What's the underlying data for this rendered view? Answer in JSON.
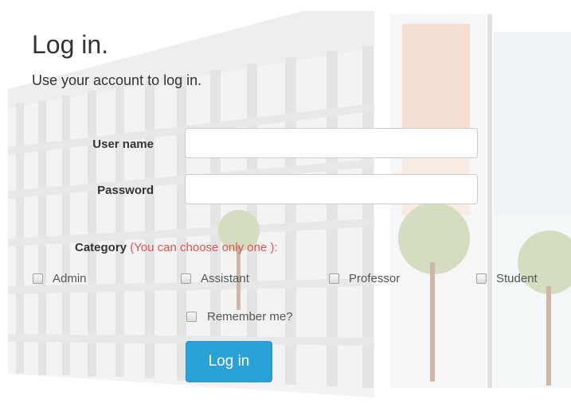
{
  "page": {
    "title": "Log in.",
    "subtitle": "Use your account to log in."
  },
  "form": {
    "username_label": "User name",
    "username_value": "",
    "password_label": "Password",
    "password_value": "",
    "category_label": "Category",
    "category_hint": "(You can choose only one ):",
    "category_options": [
      "Admin",
      "Assistant",
      "Professor",
      "Student"
    ],
    "remember_label": "Remember me?",
    "remember_checked": false,
    "submit_label": "Log in"
  },
  "colors": {
    "button": "#2aa1d7",
    "hint": "#d9534f",
    "text": "#333333"
  }
}
